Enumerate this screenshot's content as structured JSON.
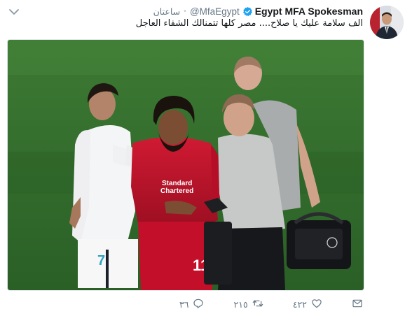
{
  "author": {
    "display_name": "Egypt MFA Spokesman",
    "handle": "@MfaEgypt",
    "time": "ساعتان",
    "verified": true
  },
  "tweet": {
    "text": "الف سلامة عليك يا صلاح.... مصر كلها تتمنالك الشفاء العاجل"
  },
  "photo": {
    "jersey_sponsor_line1": "Standard",
    "jersey_sponsor_line2": "Chartered",
    "salah_number": "11",
    "ronaldo_number": "7"
  },
  "actions": {
    "reply_count": "٣٦",
    "retweet_count": "٢١٥",
    "like_count": "٤٢٢"
  },
  "colors": {
    "verified": "#1da1f2",
    "muted": "#657786",
    "pitch": "#2f6a2a",
    "liverpool_red": "#c8102e"
  }
}
